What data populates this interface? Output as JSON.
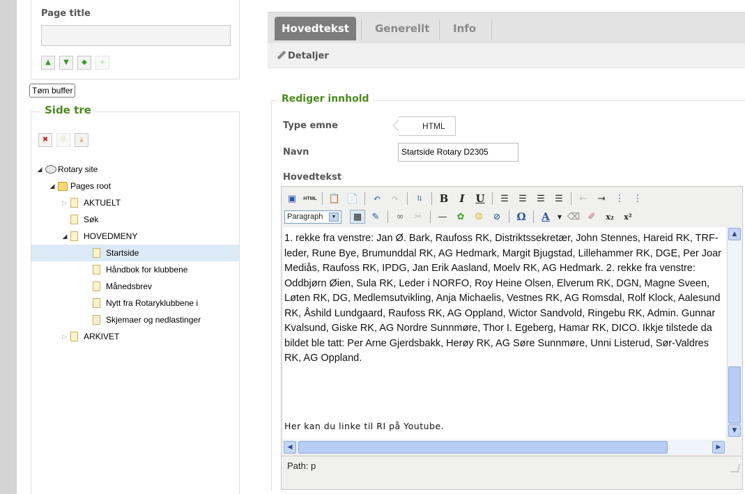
{
  "left": {
    "page_title_label": "Page title",
    "page_title_value": "",
    "clear_buffer_label": "Tøm buffer",
    "tree_legend": "Side tre",
    "tree": [
      {
        "label": "Rotary site",
        "level": 0,
        "icon": "globe-icon",
        "toggle": "open"
      },
      {
        "label": "Pages root",
        "level": 1,
        "icon": "folder-icon",
        "toggle": "open"
      },
      {
        "label": "AKTUELT",
        "level": 2,
        "icon": "page-icon",
        "toggle": "closed"
      },
      {
        "label": "Søk",
        "level": 2,
        "icon": "page-icon",
        "toggle": "none"
      },
      {
        "label": "HOVEDMENY",
        "level": 2,
        "icon": "page-icon",
        "toggle": "open"
      },
      {
        "label": "Startside",
        "level": 3,
        "icon": "page-icon",
        "toggle": "none",
        "selected": true
      },
      {
        "label": "Håndbok for klubbene",
        "level": 3,
        "icon": "page-icon",
        "toggle": "none"
      },
      {
        "label": "Månedsbrev",
        "level": 3,
        "icon": "page-icon",
        "toggle": "none"
      },
      {
        "label": "Nytt fra Rotaryklubbene i",
        "level": 3,
        "icon": "page-icon",
        "toggle": "none"
      },
      {
        "label": "Skjemaer og nedlastinger",
        "level": 3,
        "icon": "page-icon",
        "toggle": "none"
      },
      {
        "label": "ARKIVET",
        "level": 2,
        "icon": "page-icon",
        "toggle": "closed"
      }
    ]
  },
  "tabs": [
    {
      "label": "Hovedtekst",
      "active": true
    },
    {
      "label": "Generellt",
      "active": false
    },
    {
      "label": "Info",
      "active": false
    }
  ],
  "subbar_label": "Detaljer",
  "form": {
    "legend": "Rediger innhold",
    "type_label": "Type emne",
    "type_value": "HTML",
    "name_label": "Navn",
    "name_value": "Startside Rotary D2305",
    "body_label": "Hovedtekst"
  },
  "editor": {
    "format_select": "Paragraph",
    "content": " 1. rekke fra venstre: Jan Ø. Bark, Raufoss RK, Distriktssekretær, John Stennes, Hareid RK, TRF-leder, Rune Bye, Brumunddal RK, AG Hedmark, Margit Bjugstad, Lillehammer RK, DGE, Per Joar Mediås, Raufoss RK, IPDG, Jan Erik Aasland, Moelv RK, AG Hedmark. 2. rekke fra venstre: Oddbjørn Øien, Sula RK, Leder i NORFO, Roy Heine Olsen, Elverum RK, DGN, Magne Sveen, Løten RK, DG, Medlemsutvikling, Anja Michaelis, Vestnes RK, AG Romsdal, Rolf Klock, Aalesund RK, Åshild Lundgaard, Raufoss RK, AG Oppland, Wictor Sandvold, Ringebu RK, Admin. Gunnar Kvalsund, Giske RK, AG Nordre Sunnmøre, Thor I. Egeberg, Hamar RK, DICO. Ikkje tilstede da bildet ble tatt: Per Arne Gjerdsbakk, Herøy RK, AG Søre Sunnmøre, Unni Listerud, Sør-Valdres RK, AG Oppland.",
    "youtube_line": "Her kan du linke til RI på Youtube.",
    "path": "Path: p"
  },
  "colors": {
    "legend_green": "#4a8a1e",
    "active_tab": "#7d7d7d",
    "selected_row": "#dce9f7"
  }
}
